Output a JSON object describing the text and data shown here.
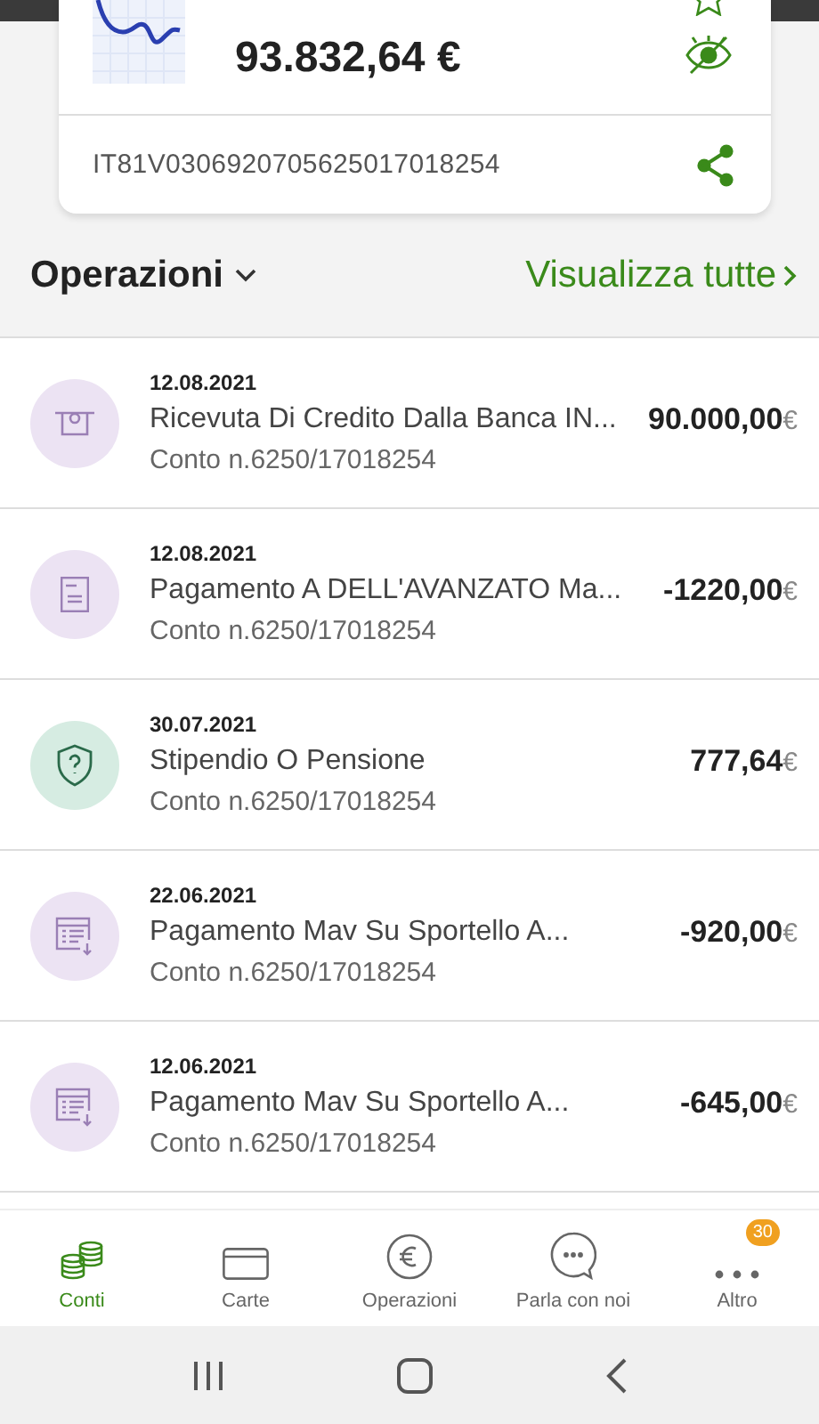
{
  "account_card": {
    "balance": "93.832,64 €",
    "iban": "IT81V0306920705625017018254"
  },
  "section": {
    "title": "Operazioni",
    "link": "Visualizza tutte"
  },
  "transactions": [
    {
      "kind": "atm",
      "date": "12.08.2021",
      "description": "Ricevuta Di Credito Dalla Banca IN...",
      "account": "Conto n.6250/17018254",
      "amount": "90.000,00",
      "currency": "€"
    },
    {
      "kind": "document",
      "date": "12.08.2021",
      "description": "Pagamento A DELL'AVANZATO Ma...",
      "account": "Conto n.6250/17018254",
      "amount": "-1220,00",
      "currency": "€"
    },
    {
      "kind": "shield",
      "date": "30.07.2021",
      "description": "Stipendio O Pensione",
      "account": "Conto n.6250/17018254",
      "amount": "777,64",
      "currency": "€"
    },
    {
      "kind": "bill",
      "date": "22.06.2021",
      "description": "Pagamento Mav Su Sportello A...",
      "account": "Conto n.6250/17018254",
      "amount": "-920,00",
      "currency": "€"
    },
    {
      "kind": "bill",
      "date": "12.06.2021",
      "description": "Pagamento Mav Su Sportello A...",
      "account": "Conto n.6250/17018254",
      "amount": "-645,00",
      "currency": "€"
    }
  ],
  "bottom_nav": [
    {
      "kind": "coins",
      "label": "Conti",
      "selected": true
    },
    {
      "kind": "card",
      "label": "Carte",
      "selected": false
    },
    {
      "kind": "euro",
      "label": "Operazioni",
      "selected": false
    },
    {
      "kind": "chat",
      "label": "Parla con noi",
      "selected": false
    },
    {
      "kind": "more",
      "label": "Altro",
      "selected": false,
      "badge": "30"
    }
  ]
}
